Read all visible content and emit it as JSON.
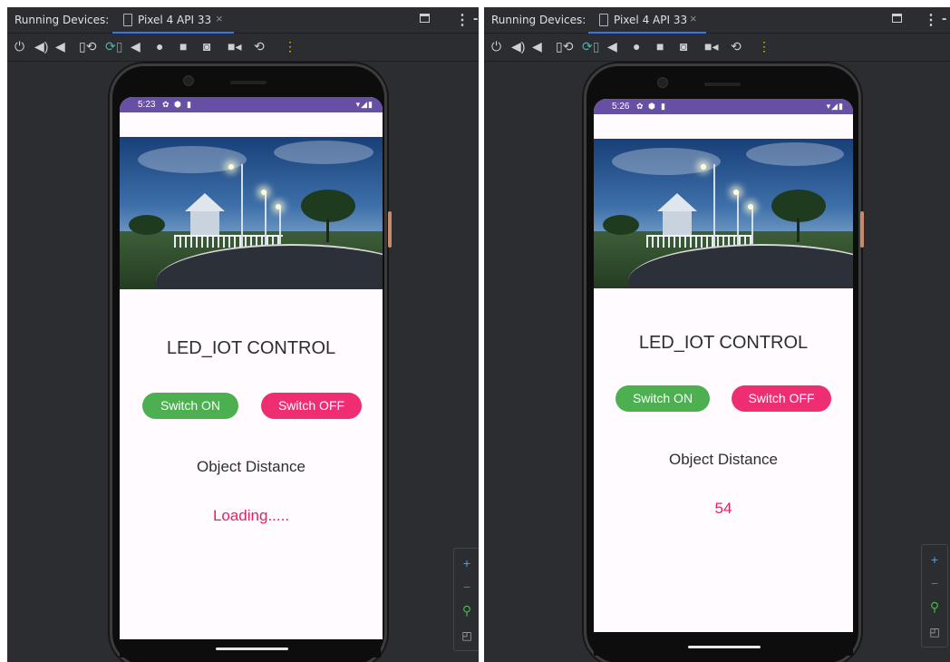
{
  "panels": [
    {
      "running_devices_label": "Running Devices:",
      "tab_title": "Pixel 4 API 33",
      "tab_close": "×",
      "more_glyph": "⋮",
      "status_time": "5:23",
      "status_right": "▾◢▮",
      "app_title": "LED_IOT CONTROL",
      "switch_on_label": "Switch ON",
      "switch_off_label": "Switch OFF",
      "distance_label": "Object Distance",
      "distance_value": "Loading.....",
      "zoom": {
        "plus": "+",
        "minus": "−",
        "zoom_icon": "⚲",
        "fit_icon": "◰"
      }
    },
    {
      "running_devices_label": "Running Devices:",
      "tab_title": "Pixel 4 API 33",
      "tab_close": "×",
      "more_glyph": "⋮",
      "status_time": "5:26",
      "status_right": "▾◢▮",
      "app_title": "LED_IOT CONTROL",
      "switch_on_label": "Switch ON",
      "switch_off_label": "Switch OFF",
      "distance_label": "Object Distance",
      "distance_value": "54",
      "zoom": {
        "plus": "+",
        "minus": "−",
        "zoom_icon": "⚲",
        "fit_icon": "◰"
      }
    }
  ],
  "toolbar_icons": [
    "power-icon",
    "volume-up-icon",
    "volume-down-icon",
    "rotate-left-icon",
    "rotate-right-icon",
    "back-icon",
    "home-icon",
    "overview-icon",
    "screenshot-icon",
    "screen-record-icon",
    "snapshot-icon",
    "more-vertical-icon"
  ],
  "toolbar_glyphs": {
    "power": "⏻",
    "vol_up": "🔊",
    "vol_down": "🔉",
    "rot_left": "⟲",
    "rot_right": "⟳",
    "back": "◀",
    "home": "●",
    "overview": "■",
    "screenshot": "📷",
    "record": "🎥",
    "snapshot": "⟲",
    "more": "⋮"
  },
  "colors": {
    "ide_bg": "#2b2d30",
    "status_bar": "#6750a4",
    "switch_on": "#4caf50",
    "switch_off": "#ef2d72",
    "distance_value": "#e91e63",
    "tab_underline": "#3574f0"
  }
}
